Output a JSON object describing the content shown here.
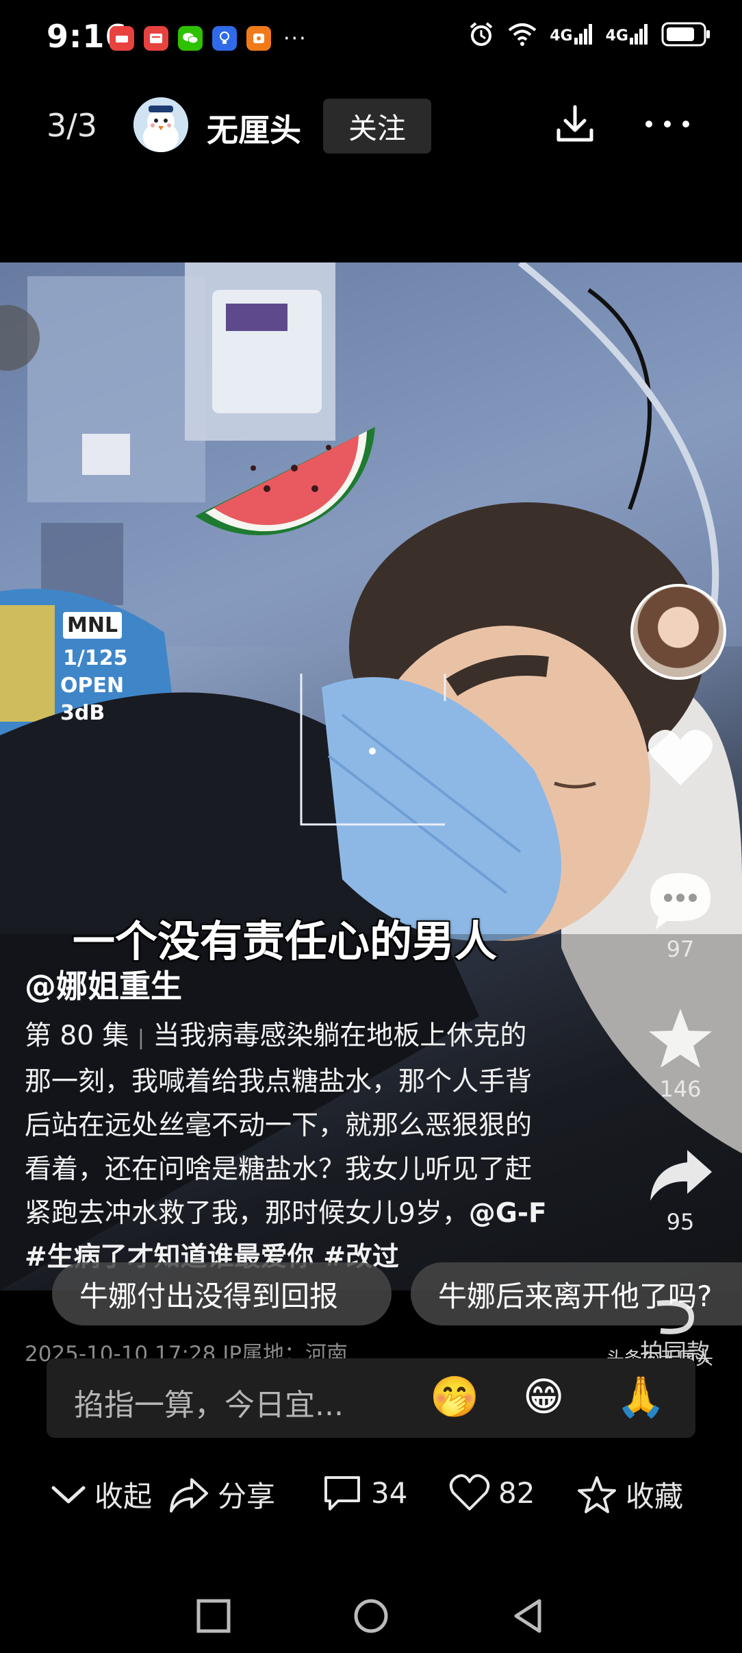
{
  "status_bar": {
    "time": "9:16",
    "notif_icons": [
      {
        "name": "huawei-app-icon",
        "color": "#e8423f"
      },
      {
        "name": "red-app-icon",
        "color": "#e8423f"
      },
      {
        "name": "wechat-icon",
        "color": "#2dc100"
      },
      {
        "name": "blue-bulb-app-icon",
        "color": "#2f6be8"
      },
      {
        "name": "orange-app-icon",
        "color": "#f07a1a"
      }
    ],
    "more_notifications": "···",
    "network_label_1": "4G",
    "network_label_2": "4G"
  },
  "header": {
    "page_counter": "3/3",
    "author_name": "无厘头",
    "follow_label": "关注"
  },
  "video": {
    "overlay_text": "一个没有责任心的男人",
    "equipment_labels": [
      "MNL",
      "1/125",
      "OPEN",
      "3dB"
    ]
  },
  "side_actions": {
    "like_count": "",
    "comment_count": "97",
    "favorite_count": "146",
    "share_count": "95"
  },
  "caption": {
    "username": "@娜姐重生",
    "episode": "第 80 集 ",
    "text": "当我病毒感染躺在地板上休克的那一刻，我喊着给我点糖盐水，那个人手背后站在远处丝毫不动一下，就那么恶狠狠的看着，还在问啥是糖盐水？我女儿听见了赶紧跑去冲水救了我，那时候女儿9岁，",
    "hashtags": "@G-F #生病了才知道谁最爱你 #改过",
    "meta": "2025-10-10 17:28  IP属地：河南"
  },
  "suggestions": [
    "牛娜付出没得到回报",
    "牛娜后来离开他了吗?"
  ],
  "watermark": "头条@无厘头",
  "watermark_sub": "拍同款",
  "input": {
    "placeholder": "掐指一算，今日宜...",
    "emojis": [
      "🤭",
      "😁",
      "🙏"
    ]
  },
  "actions": {
    "collapse_label": "收起",
    "share_label": "分享",
    "comment_count": "34",
    "like_count": "82",
    "favorite_label": "收藏"
  }
}
